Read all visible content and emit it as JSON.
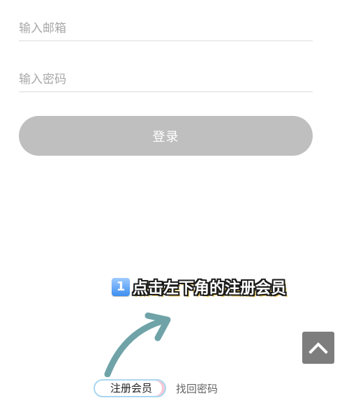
{
  "login_form": {
    "email_placeholder": "输入邮箱",
    "password_placeholder": "输入密码",
    "login_label": "登录"
  },
  "annotation": {
    "step_number": "1",
    "text": "点击左下角的注册会员"
  },
  "footer": {
    "register_label": "注册会员",
    "reset_password_label": "找回密码"
  },
  "icons": {
    "back_to_top": "chevron-up-icon",
    "pointer_arrow": "curved-arrow-icon"
  },
  "colors": {
    "login_button_bg": "#bfbfbf",
    "back_to_top_bg": "#7d7d7d",
    "arrow_color": "#6fa3a8"
  }
}
